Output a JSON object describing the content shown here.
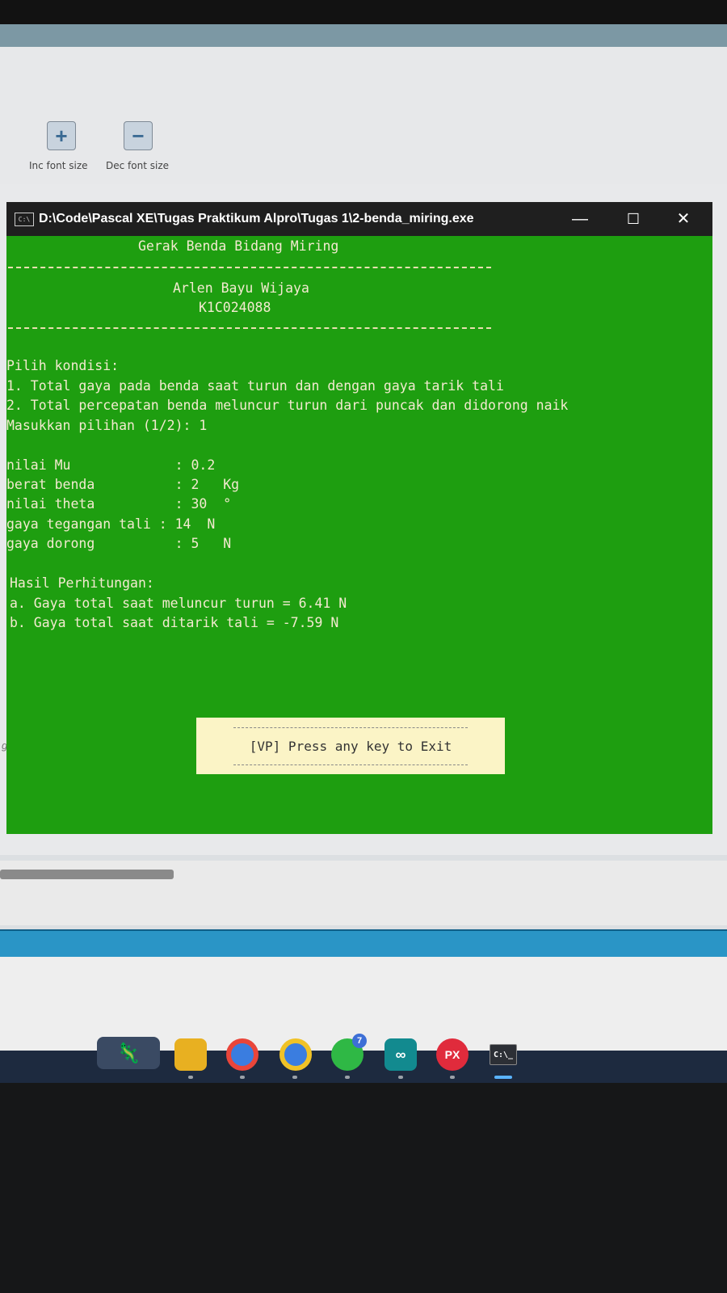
{
  "ide": {
    "toolbar": {
      "inc_font_label": "Inc font size",
      "dec_font_label": "Dec font size"
    },
    "side_fragment": "ga"
  },
  "console": {
    "title": "D:\\Code\\Pascal XE\\Tugas Praktikum Alpro\\Tugas 1\\2-benda_miring.exe",
    "icon_text": "C:\\",
    "controls": {
      "minimize": "—",
      "maximize": "☐",
      "close": "✕"
    },
    "lines": {
      "heading": "Gerak Benda Bidang Miring",
      "author": "Arlen Bayu Wijaya",
      "student_id": "K1C024088",
      "prompt_title": "Pilih kondisi:",
      "option1": "1. Total gaya pada benda saat turun dan dengan gaya tarik tali",
      "option2": "2. Total percepatan benda meluncur turun dari puncak dan didorong naik",
      "choice": "Masukkan pilihan (1/2): 1",
      "mu": "nilai Mu             : 0.2",
      "berat": "berat benda          : 2   Kg",
      "theta": "nilai theta          : 30  °",
      "tegangan": "gaya tegangan tali : 14  N",
      "dorong": "gaya dorong          : 5   N",
      "result_title": "Hasil Perhitungan:",
      "result_a": "a. Gaya total saat meluncur turun = 6.41 N",
      "result_b": "b. Gaya total saat ditarik tali = -7.59 N"
    },
    "exit_message": "[VP] Press any key to Exit"
  },
  "taskbar": {
    "apps": [
      {
        "name": "File Explorer",
        "icon": "folder-icon"
      },
      {
        "name": "Chrome",
        "icon": "chrome-icon"
      },
      {
        "name": "Chrome Profile",
        "icon": "chrome-profile-icon"
      },
      {
        "name": "WhatsApp",
        "icon": "whatsapp-icon",
        "badge": "7"
      },
      {
        "name": "Arduino",
        "icon": "arduino-icon",
        "text": "∞"
      },
      {
        "name": "PX",
        "icon": "px-icon",
        "text": "PX"
      },
      {
        "name": "Terminal",
        "icon": "terminal-icon",
        "text": "C:\\_"
      }
    ]
  },
  "colors": {
    "console_bg": "#1e9e10",
    "console_text": "#f3ead0",
    "exit_box_bg": "#fbf4c6",
    "taskbar_bg": "#1d2a3f"
  }
}
